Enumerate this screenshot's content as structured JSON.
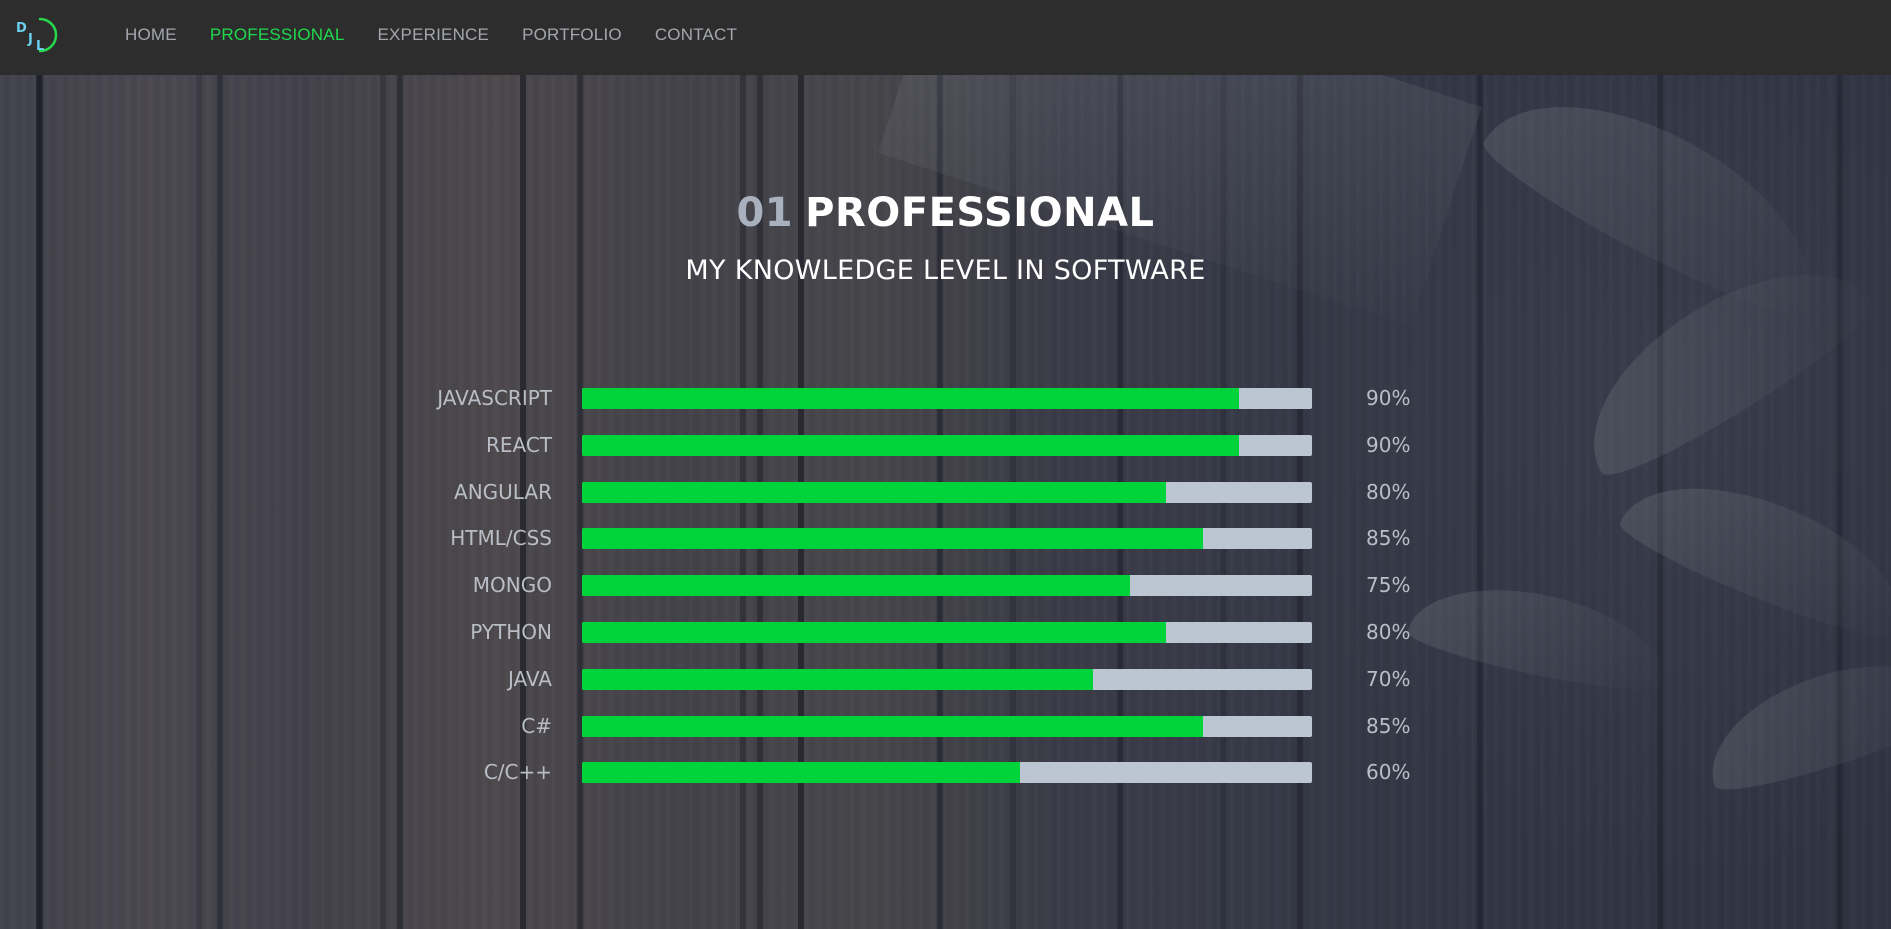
{
  "nav": {
    "logo_alt": "DJL",
    "items": [
      {
        "label": "HOME",
        "active": false
      },
      {
        "label": "PROFESSIONAL",
        "active": true
      },
      {
        "label": "EXPERIENCE",
        "active": false
      },
      {
        "label": "PORTFOLIO",
        "active": false
      },
      {
        "label": "CONTACT",
        "active": false
      }
    ]
  },
  "section": {
    "number": "01",
    "title": "PROFESSIONAL",
    "subtitle": "MY KNOWLEDGE LEVEL IN SOFTWARE"
  },
  "skills": [
    {
      "name": "JAVASCRIPT",
      "percent": 90,
      "label": "90%"
    },
    {
      "name": "REACT",
      "percent": 90,
      "label": "90%"
    },
    {
      "name": "ANGULAR",
      "percent": 80,
      "label": "80%"
    },
    {
      "name": "HTML/CSS",
      "percent": 85,
      "label": "85%"
    },
    {
      "name": "MONGO",
      "percent": 75,
      "label": "75%"
    },
    {
      "name": "PYTHON",
      "percent": 80,
      "label": "80%"
    },
    {
      "name": "JAVA",
      "percent": 70,
      "label": "70%"
    },
    {
      "name": "C#",
      "percent": 85,
      "label": "85%"
    },
    {
      "name": "C/C++",
      "percent": 60,
      "label": "60%"
    }
  ],
  "colors": {
    "accent": "#1fd94d",
    "bar_fill": "#00d43a",
    "bar_track": "#bcc6d3",
    "navbar": "#2d2d2d"
  }
}
